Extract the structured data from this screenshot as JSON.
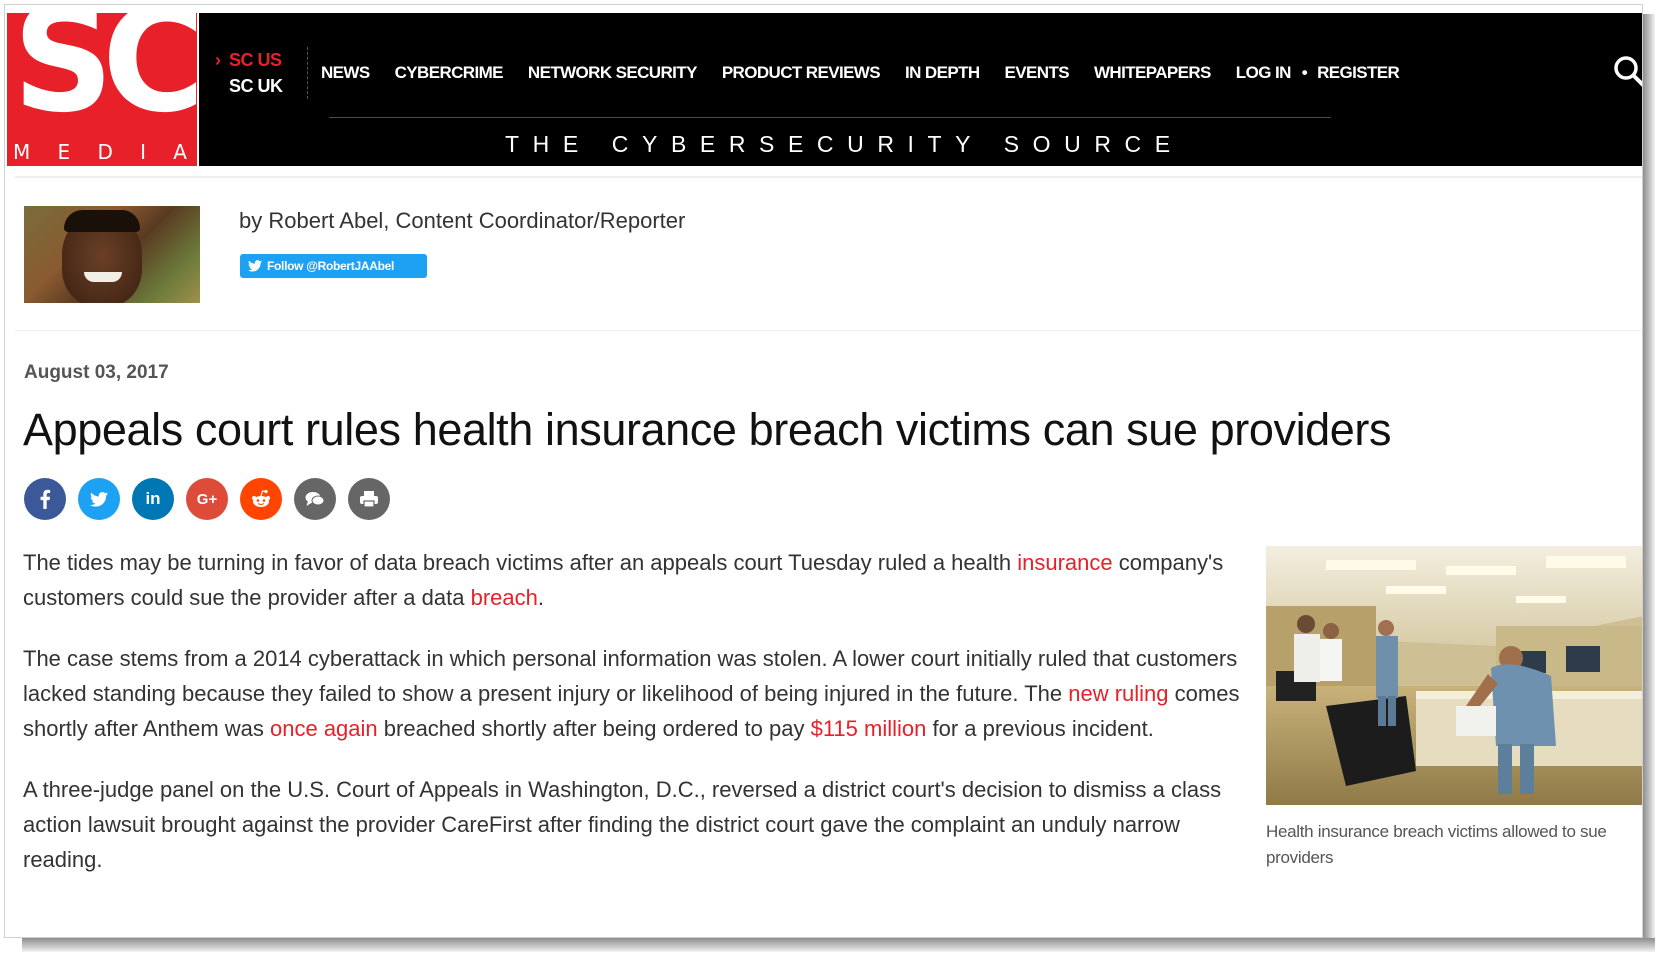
{
  "brand": {
    "logo_text": "SC",
    "logo_subtext": "MEDIA",
    "accent_color": "#e8202a",
    "link_color": "#e8202a",
    "twitter_color": "#1da1f2"
  },
  "editions": {
    "chevron": "›",
    "current": "SC US",
    "other": "SC UK"
  },
  "nav": {
    "items": [
      "NEWS",
      "CYBERCRIME",
      "NETWORK SECURITY",
      "PRODUCT REVIEWS",
      "IN DEPTH",
      "EVENTS",
      "WHITEPAPERS"
    ],
    "login": "LOG IN",
    "separator": "•",
    "register": "REGISTER"
  },
  "tagline": "THE CYBERSECURITY SOURCE",
  "author": {
    "byline": "by Robert Abel, Content Coordinator/Reporter",
    "follow_label": "Follow @RobertJAAbel"
  },
  "article": {
    "date": "August 03, 2017",
    "title": "Appeals court rules health insurance breach victims can sue providers",
    "share_buttons": [
      {
        "icon": "facebook-icon",
        "glyph": "f",
        "color": "#3b5998"
      },
      {
        "icon": "twitter-icon",
        "glyph": "t",
        "color": "#1da1f2"
      },
      {
        "icon": "linkedin-icon",
        "glyph": "in",
        "color": "#0077b5"
      },
      {
        "icon": "google-plus-icon",
        "glyph": "G+",
        "color": "#dd4b39"
      },
      {
        "icon": "reddit-icon",
        "glyph": "r",
        "color": "#ff4500"
      },
      {
        "icon": "comment-icon",
        "glyph": "c",
        "color": "#666666"
      },
      {
        "icon": "print-icon",
        "glyph": "p",
        "color": "#666666"
      }
    ],
    "p1": {
      "t1": "The tides may be turning in favor of data breach victims after an appeals court Tuesday ruled a health ",
      "l1": "insurance",
      "t2": " company's customers could sue the provider after a data ",
      "l2": "breach",
      "t3": "."
    },
    "p2": {
      "t1": "The case stems from a 2014 cyberattack in which personal information was stolen. A lower court initially ruled that customers lacked standing because they failed to show a present injury or likelihood of being injured in the future. The ",
      "l1": "new ruling",
      "t2": " comes shortly after Anthem was ",
      "l2": "once again",
      "t3": " breached shortly after being ordered to pay ",
      "l3": "$115 million",
      "t4": " for a previous incident."
    },
    "p3": "A three-judge panel on the U.S. Court of Appeals in Washington, D.C., reversed a district court's decision to dismiss a class action lawsuit brought against the provider CareFirst after finding the district court gave the complaint an unduly narrow reading.",
    "photo_caption": "Health insurance breach victims allowed to sue providers"
  }
}
